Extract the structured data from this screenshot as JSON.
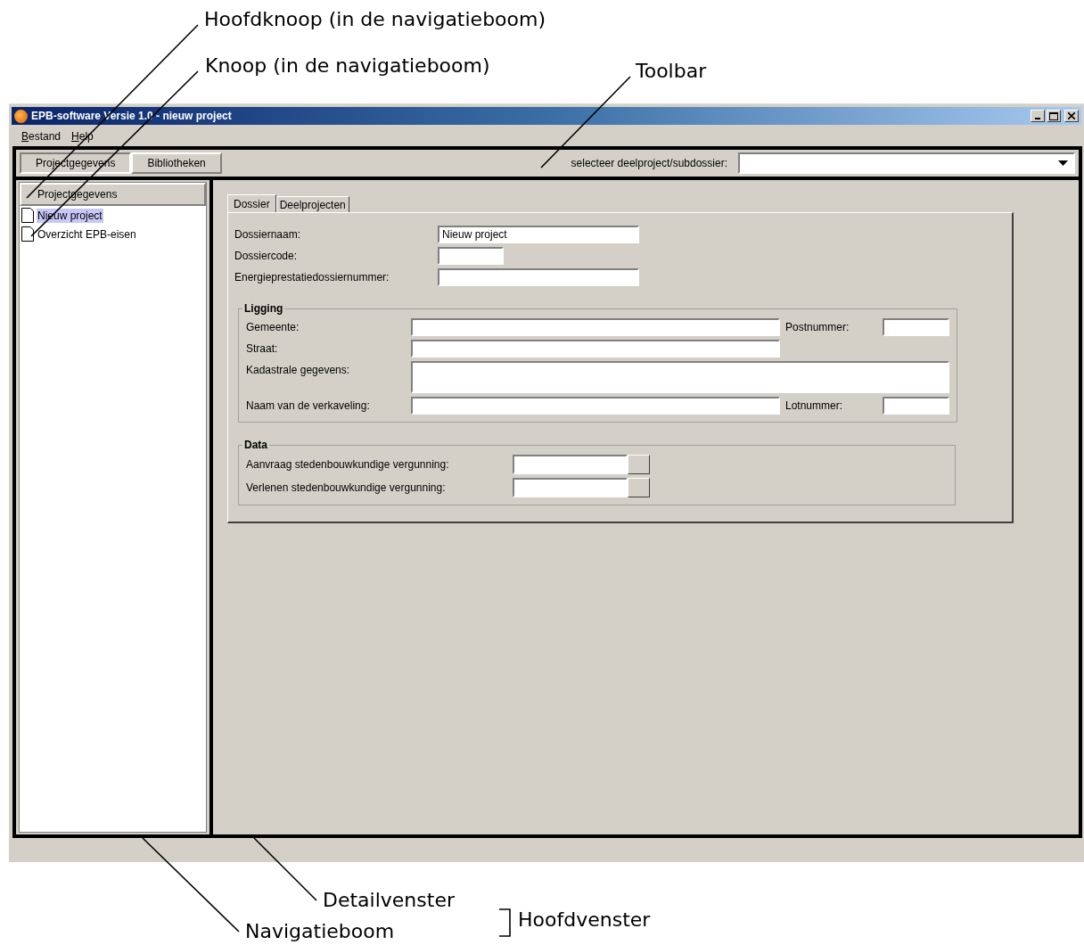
{
  "annotations": [
    {
      "text": "Hoofdknoop (in de navigatieboom)"
    },
    {
      "text": "Knoop (in de navigatieboom)"
    },
    {
      "text": "Toolbar"
    },
    {
      "text": "Detailvenster"
    },
    {
      "text": "Navigatieboom"
    },
    {
      "text": "Hoofdvenster"
    }
  ],
  "window": {
    "title": "EPB-software Versie 1.0 - nieuw project"
  },
  "menu": [
    "Bestand",
    "Help"
  ],
  "toolbar": {
    "buttons": [
      {
        "label": "Projectgegevens",
        "selected": true
      },
      {
        "label": "Bibliotheken",
        "selected": false
      }
    ],
    "selector_label": "selecteer deelproject/subdossier:"
  },
  "navigation": {
    "root": "Projectgegevens",
    "items": [
      {
        "label": "Nieuw project",
        "selected": true
      },
      {
        "label": "Overzicht EPB-eisen",
        "selected": false
      }
    ]
  },
  "detail": {
    "tabs": [
      {
        "label": "Dossier",
        "selected": true
      },
      {
        "label": "Deelprojecten",
        "selected": false
      }
    ],
    "fields": [
      {
        "kind": "long",
        "label": "Dossiernaam:",
        "value": "Nieuw project"
      },
      {
        "kind": "short",
        "label": "Dossiercode:"
      },
      {
        "kind": "long",
        "label": "Energieprestatiedossiernummer:"
      }
    ],
    "groups": [
      {
        "title": "Ligging",
        "rows": [
          {
            "kind": "wide_with_side",
            "label": "Gemeente:",
            "side_label": "Postnummer:"
          },
          {
            "kind": "wide",
            "label": "Straat:"
          },
          {
            "kind": "area",
            "label": "Kadastrale gegevens:"
          },
          {
            "kind": "wide_with_side",
            "label": "Naam van de verkaveling:",
            "side_label": "Lotnummer:"
          }
        ]
      },
      {
        "title": "Data",
        "rows": [
          {
            "kind": "date",
            "label": "Aanvraag stedenbouwkundige vergunning:"
          },
          {
            "kind": "date",
            "label": "Verlenen stedenbouwkundige vergunning:"
          }
        ]
      }
    ]
  }
}
